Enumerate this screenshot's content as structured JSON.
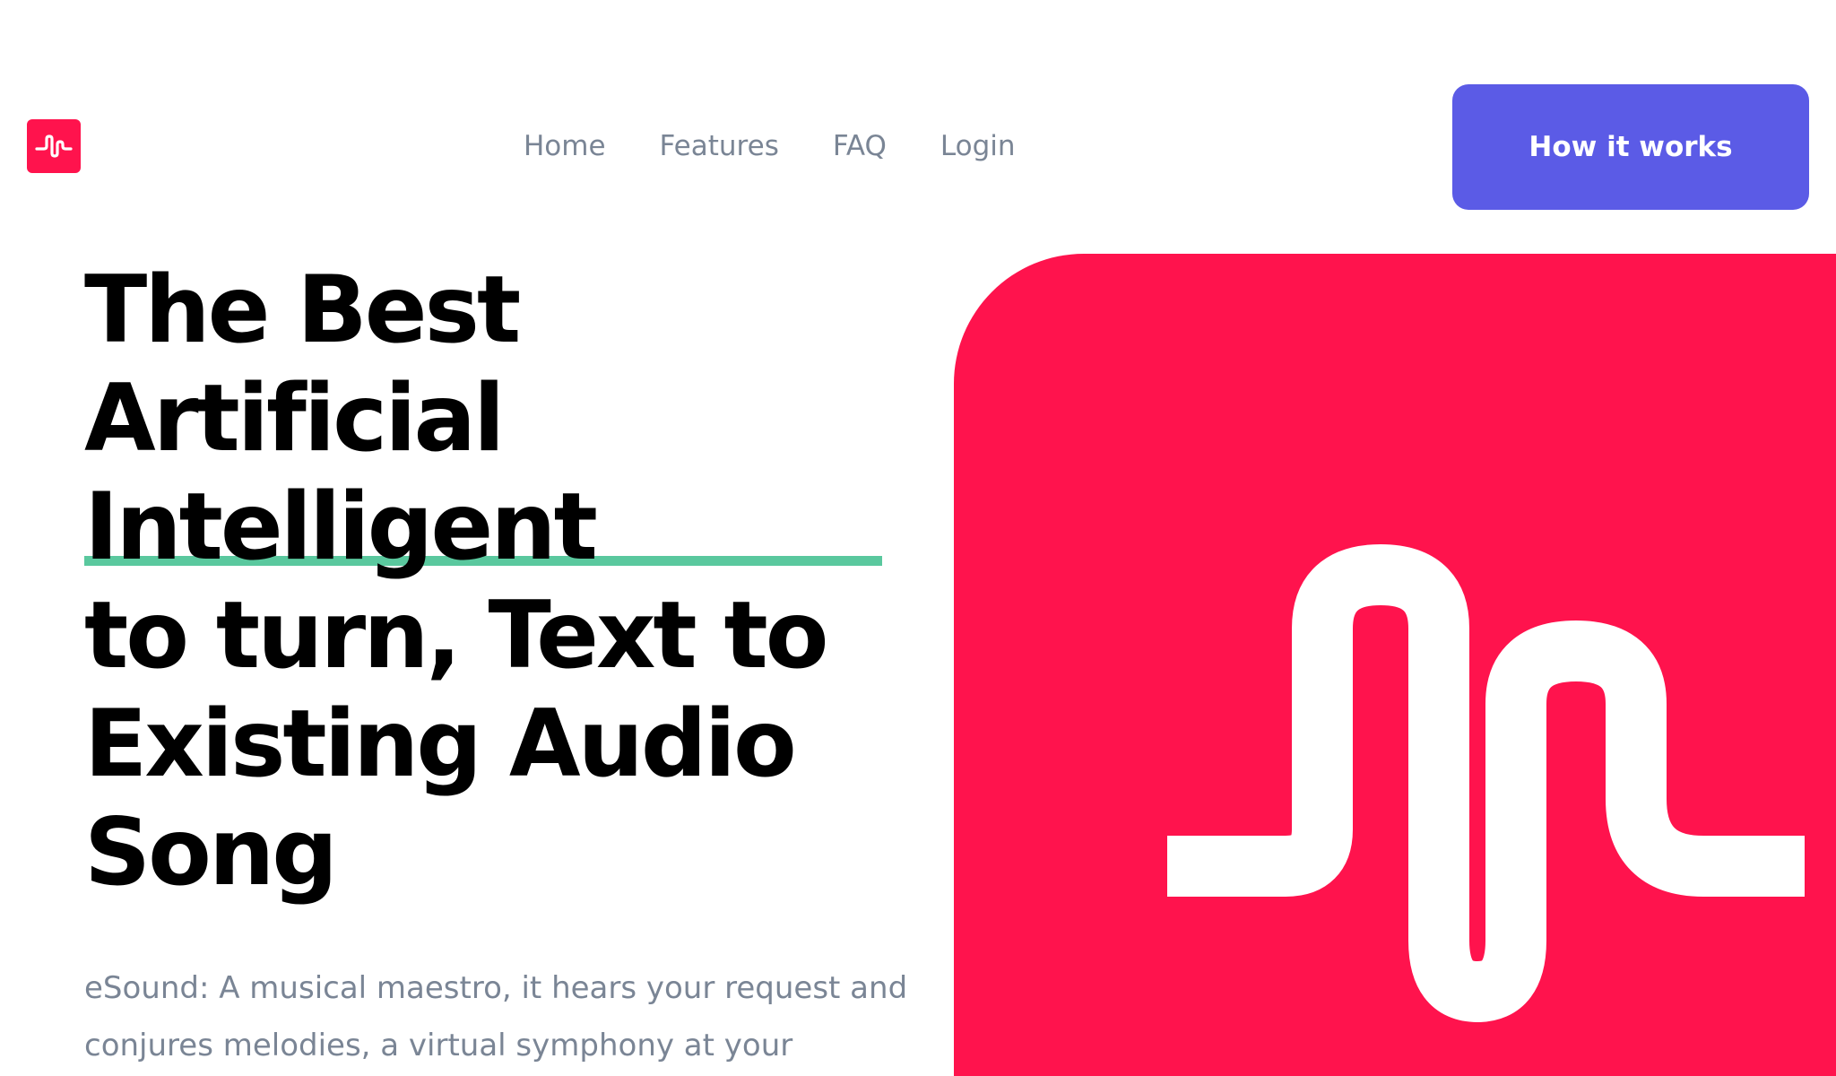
{
  "brand": {
    "logo_icon": "musically-wave-icon",
    "color": "#ff134d"
  },
  "nav": {
    "items": [
      {
        "label": "Home"
      },
      {
        "label": "Features"
      },
      {
        "label": "FAQ"
      },
      {
        "label": "Login"
      }
    ]
  },
  "header": {
    "cta_label": "How it works",
    "cta_color": "#5b5be6"
  },
  "hero": {
    "headline_lines": [
      "The Best",
      "Artificial",
      "Intelligent",
      "to turn, Text to",
      "Existing Audio",
      "Song"
    ],
    "subtitle": "eSound: A musical maestro, it hears your request and conjures melodies, a virtual symphony at your",
    "underline_color": "#5ac89e",
    "image_icon": "musically-wave-icon"
  }
}
